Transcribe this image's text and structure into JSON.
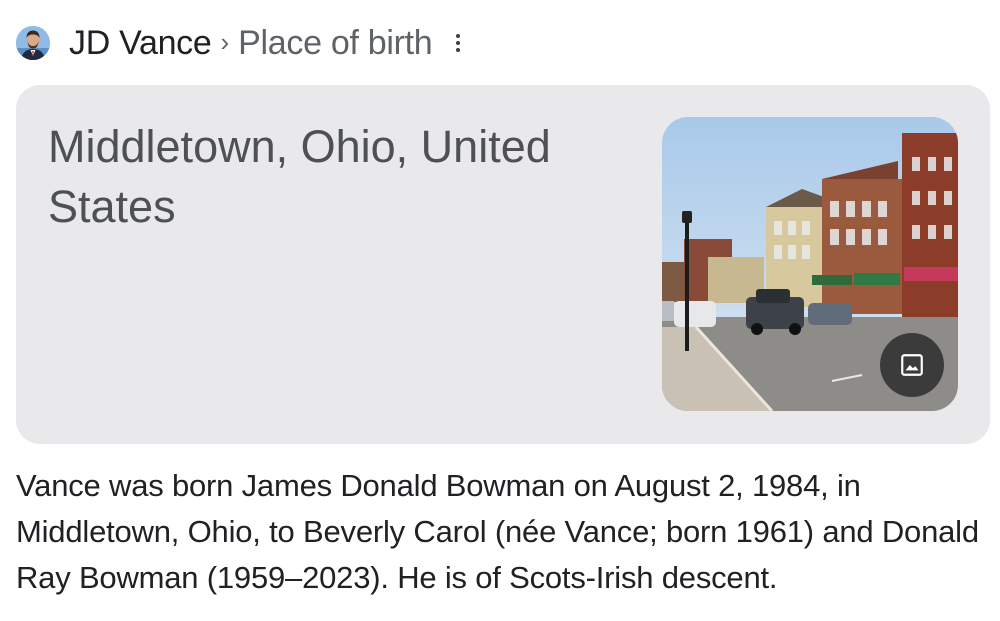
{
  "breadcrumb": {
    "entity": "JD Vance",
    "separator": "›",
    "attribute": "Place of birth"
  },
  "answer": {
    "value": "Middletown, Ohio, United States"
  },
  "snippet": {
    "text": "Vance was born James Donald Bowman on August 2, 1984, in Middletown, Ohio, to Beverly Carol (née Vance; born 1961) and Donald Ray Bowman (1959–2023). He is of Scots-Irish descent."
  },
  "icons": {
    "avatar": "person-avatar",
    "more": "more-vert-icon",
    "image_button": "image-icon"
  },
  "colors": {
    "card_background": "#e9e9eb",
    "answer_text": "#4d5156",
    "muted_text": "#5f6368",
    "image_button": "#303030"
  }
}
